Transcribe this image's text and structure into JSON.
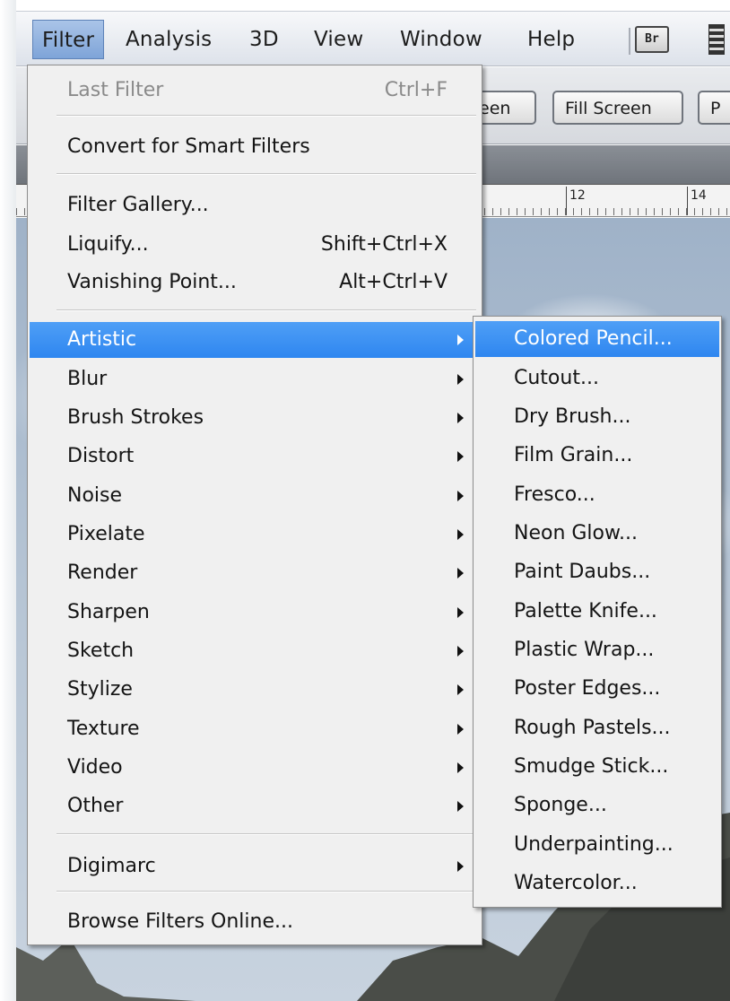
{
  "menubar": {
    "items": [
      "Filter",
      "Analysis",
      "3D",
      "View",
      "Window",
      "Help"
    ],
    "bridge_icon": "Br"
  },
  "options_bar": {
    "buttons": [
      "een",
      "Fill Screen",
      "P"
    ]
  },
  "ruler": {
    "labels": [
      "12",
      "14"
    ]
  },
  "filter_menu": {
    "last_filter": {
      "label": "Last Filter",
      "shortcut": "Ctrl+F"
    },
    "convert": "Convert for Smart Filters",
    "filter_gallery": "Filter Gallery...",
    "liquify": {
      "label": "Liquify...",
      "shortcut": "Shift+Ctrl+X"
    },
    "vanishing_point": {
      "label": "Vanishing Point...",
      "shortcut": "Alt+Ctrl+V"
    },
    "categories": [
      "Artistic",
      "Blur",
      "Brush Strokes",
      "Distort",
      "Noise",
      "Pixelate",
      "Render",
      "Sharpen",
      "Sketch",
      "Stylize",
      "Texture",
      "Video",
      "Other"
    ],
    "digimarc": "Digimarc",
    "browse": "Browse Filters Online..."
  },
  "artistic_submenu": {
    "items": [
      "Colored Pencil...",
      "Cutout...",
      "Dry Brush...",
      "Film Grain...",
      "Fresco...",
      "Neon Glow...",
      "Paint Daubs...",
      "Palette Knife...",
      "Plastic Wrap...",
      "Poster Edges...",
      "Rough Pastels...",
      "Smudge Stick...",
      "Sponge...",
      "Underpainting...",
      "Watercolor..."
    ]
  },
  "colors": {
    "highlight": "#3a8ff2",
    "menu_bg": "#f0f0f0"
  }
}
